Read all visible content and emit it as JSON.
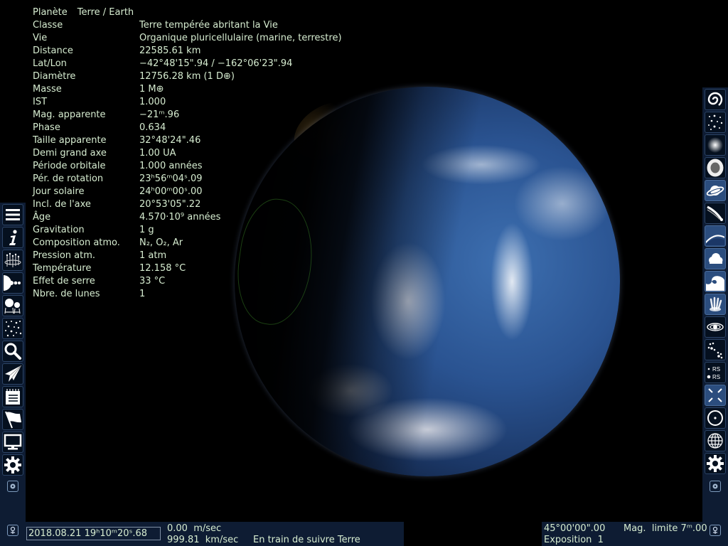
{
  "info_panel": {
    "title_label": "Planète",
    "title_value": "Terre / Earth",
    "rows": [
      {
        "label": "Classe",
        "value": "Terre tempérée abritant la Vie"
      },
      {
        "label": "Vie",
        "value": "Organique pluricellulaire (marine, terrestre)"
      },
      {
        "label": "Distance",
        "value": "22585.61 km"
      },
      {
        "label": "Lat/Lon",
        "value": "−42°48'15\".94 / −162°06'23\".94"
      },
      {
        "label": "Diamètre",
        "value": "12756.28 km (1 D⊕)"
      },
      {
        "label": "Masse",
        "value": "1 M⊕"
      },
      {
        "label": "IST",
        "value": "1.000"
      },
      {
        "label": "Mag. apparente",
        "value": "−21ᵐ.96"
      },
      {
        "label": "Phase",
        "value": "0.634"
      },
      {
        "label": "Taille apparente",
        "value": "32°48'24\".46"
      },
      {
        "label": "Demi grand axe",
        "value": "1.00 UA"
      },
      {
        "label": "Période orbitale",
        "value": "1.000 années"
      },
      {
        "label": "Pér. de rotation",
        "value": "23ʰ56ᵐ04ˢ.09"
      },
      {
        "label": "Jour solaire",
        "value": "24ʰ00ᵐ00ˢ.00"
      },
      {
        "label": "Incl. de l'axe",
        "value": "20°53'05\".22"
      },
      {
        "label": "Âge",
        "value": "4.570·10⁹ années"
      },
      {
        "label": "Gravitation",
        "value": "1 g"
      },
      {
        "label": "Composition atmo.",
        "value": "N₂, O₂, Ar"
      },
      {
        "label": "Pression atm.",
        "value": "1 atm"
      },
      {
        "label": "Température",
        "value": "12.158 °C"
      },
      {
        "label": "Effet de serre",
        "value": "33 °C"
      },
      {
        "label": "Nbre. de lunes",
        "value": "1"
      }
    ]
  },
  "left_toolbar": [
    {
      "icon": "menu-icon",
      "active": false
    },
    {
      "icon": "info-icon",
      "active": false
    },
    {
      "icon": "star-system-icon",
      "active": false
    },
    {
      "icon": "planets-icon",
      "active": false
    },
    {
      "icon": "compare-size-icon",
      "active": false
    },
    {
      "icon": "star-field-icon",
      "active": false
    },
    {
      "icon": "search-icon",
      "active": false
    },
    {
      "icon": "spaceship-icon",
      "active": false
    },
    {
      "icon": "notepad-icon",
      "active": false
    },
    {
      "icon": "flag-icon",
      "active": false
    },
    {
      "icon": "display-icon",
      "active": false
    },
    {
      "icon": "gear-icon",
      "active": false
    }
  ],
  "right_toolbar": [
    {
      "icon": "galaxy-icon",
      "active": false
    },
    {
      "icon": "stars-icon",
      "active": false
    },
    {
      "icon": "star-cluster-icon",
      "active": false
    },
    {
      "icon": "nebula-icon",
      "active": false
    },
    {
      "icon": "planet-ring-icon",
      "active": true
    },
    {
      "icon": "comet-icon",
      "active": false
    },
    {
      "icon": "atmosphere-icon",
      "active": true
    },
    {
      "icon": "cloud-icon",
      "active": true
    },
    {
      "icon": "wave-icon",
      "active": true
    },
    {
      "icon": "aurora-icon",
      "active": true
    },
    {
      "icon": "orbit-icon",
      "active": false
    },
    {
      "icon": "constellation-icon",
      "active": false
    },
    {
      "icon": "label-size-icon",
      "active": false
    },
    {
      "icon": "expand-icon",
      "active": true
    },
    {
      "icon": "target-icon",
      "active": false
    },
    {
      "icon": "grid-globe-icon",
      "active": false
    },
    {
      "icon": "gear-icon",
      "active": false
    }
  ],
  "label_size_text": "RS",
  "bottom": {
    "datetime": "2018.08.21 19ʰ10ᵐ20ˢ.68",
    "speed": "0.00  m/sec",
    "speed2": "999.81  km/sec",
    "status": "En train de suivre Terre",
    "fov": "45°00'00\".00",
    "mag_limit": "Mag.  limite 7ᵐ.00",
    "exposure": "Exposition  1"
  },
  "colors": {
    "text": "#d6ecd0",
    "panel": "#0e1c33",
    "button_active": "#2b4d7e"
  }
}
